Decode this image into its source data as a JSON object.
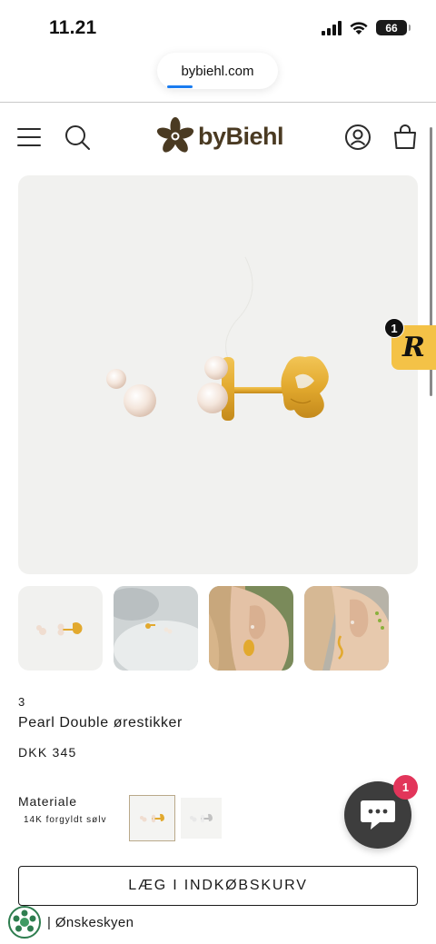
{
  "status_bar": {
    "time": "11.21",
    "battery": "66"
  },
  "browser": {
    "url": "bybiehl.com"
  },
  "header": {
    "logo_text": "byBiehl",
    "icons": [
      "menu-icon",
      "search-icon",
      "account-icon",
      "cart-icon"
    ]
  },
  "gallery": {
    "thumbnail_count": 4,
    "review_widget": {
      "letter": "R",
      "badge": "1"
    }
  },
  "product": {
    "review_count": "3",
    "title": "Pearl Double ørestikker",
    "price": "DKK 345"
  },
  "options": {
    "material_label": "Materiale",
    "material_value": "14K forgyldt sølv"
  },
  "actions": {
    "add_to_cart": "LÆG I INDKØBSKURV",
    "wishlist": "| Ønskeskyen"
  },
  "chat": {
    "badge": "1"
  },
  "colors": {
    "logo_brown": "#4a3a22",
    "gold": "#e2a92e",
    "review_yellow": "#f4c247",
    "chat_bg": "#3d3d3d",
    "badge_red": "#e2355a"
  }
}
